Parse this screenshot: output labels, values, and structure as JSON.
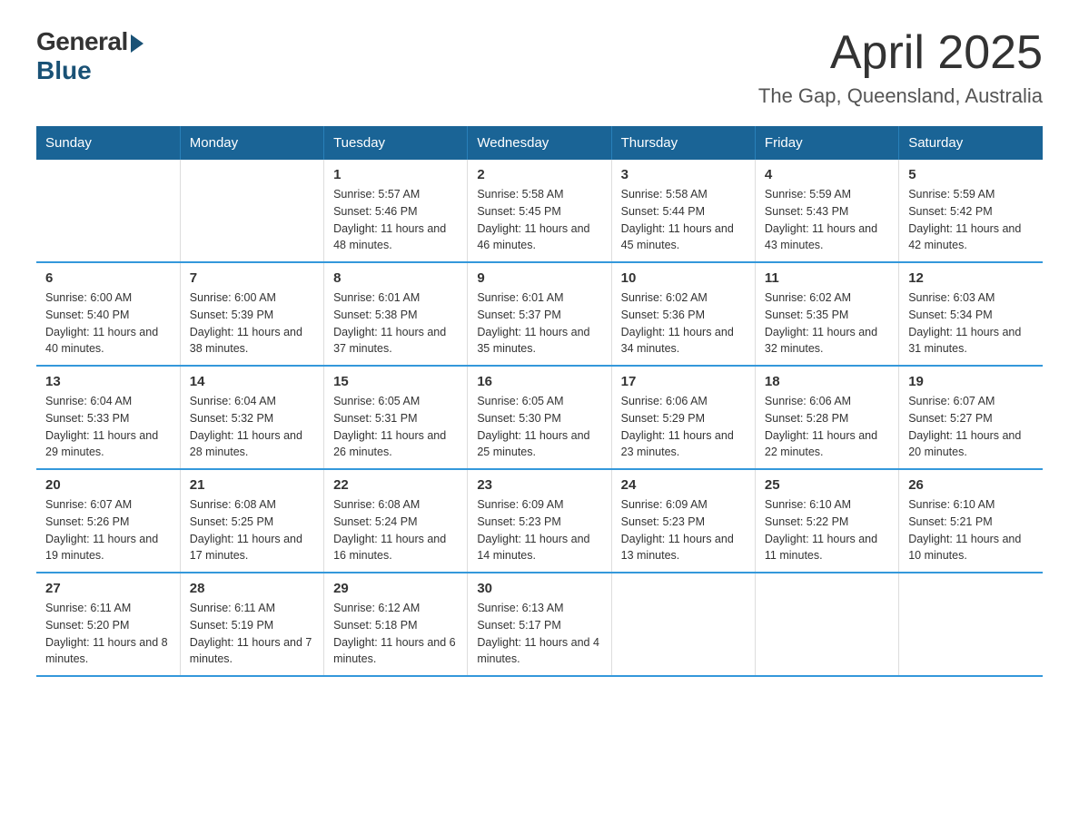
{
  "header": {
    "logo": {
      "general": "General",
      "blue": "Blue"
    },
    "title": "April 2025",
    "subtitle": "The Gap, Queensland, Australia"
  },
  "calendar": {
    "days_of_week": [
      "Sunday",
      "Monday",
      "Tuesday",
      "Wednesday",
      "Thursday",
      "Friday",
      "Saturday"
    ],
    "weeks": [
      [
        {
          "day": "",
          "sunrise": "",
          "sunset": "",
          "daylight": ""
        },
        {
          "day": "",
          "sunrise": "",
          "sunset": "",
          "daylight": ""
        },
        {
          "day": "1",
          "sunrise": "Sunrise: 5:57 AM",
          "sunset": "Sunset: 5:46 PM",
          "daylight": "Daylight: 11 hours and 48 minutes."
        },
        {
          "day": "2",
          "sunrise": "Sunrise: 5:58 AM",
          "sunset": "Sunset: 5:45 PM",
          "daylight": "Daylight: 11 hours and 46 minutes."
        },
        {
          "day": "3",
          "sunrise": "Sunrise: 5:58 AM",
          "sunset": "Sunset: 5:44 PM",
          "daylight": "Daylight: 11 hours and 45 minutes."
        },
        {
          "day": "4",
          "sunrise": "Sunrise: 5:59 AM",
          "sunset": "Sunset: 5:43 PM",
          "daylight": "Daylight: 11 hours and 43 minutes."
        },
        {
          "day": "5",
          "sunrise": "Sunrise: 5:59 AM",
          "sunset": "Sunset: 5:42 PM",
          "daylight": "Daylight: 11 hours and 42 minutes."
        }
      ],
      [
        {
          "day": "6",
          "sunrise": "Sunrise: 6:00 AM",
          "sunset": "Sunset: 5:40 PM",
          "daylight": "Daylight: 11 hours and 40 minutes."
        },
        {
          "day": "7",
          "sunrise": "Sunrise: 6:00 AM",
          "sunset": "Sunset: 5:39 PM",
          "daylight": "Daylight: 11 hours and 38 minutes."
        },
        {
          "day": "8",
          "sunrise": "Sunrise: 6:01 AM",
          "sunset": "Sunset: 5:38 PM",
          "daylight": "Daylight: 11 hours and 37 minutes."
        },
        {
          "day": "9",
          "sunrise": "Sunrise: 6:01 AM",
          "sunset": "Sunset: 5:37 PM",
          "daylight": "Daylight: 11 hours and 35 minutes."
        },
        {
          "day": "10",
          "sunrise": "Sunrise: 6:02 AM",
          "sunset": "Sunset: 5:36 PM",
          "daylight": "Daylight: 11 hours and 34 minutes."
        },
        {
          "day": "11",
          "sunrise": "Sunrise: 6:02 AM",
          "sunset": "Sunset: 5:35 PM",
          "daylight": "Daylight: 11 hours and 32 minutes."
        },
        {
          "day": "12",
          "sunrise": "Sunrise: 6:03 AM",
          "sunset": "Sunset: 5:34 PM",
          "daylight": "Daylight: 11 hours and 31 minutes."
        }
      ],
      [
        {
          "day": "13",
          "sunrise": "Sunrise: 6:04 AM",
          "sunset": "Sunset: 5:33 PM",
          "daylight": "Daylight: 11 hours and 29 minutes."
        },
        {
          "day": "14",
          "sunrise": "Sunrise: 6:04 AM",
          "sunset": "Sunset: 5:32 PM",
          "daylight": "Daylight: 11 hours and 28 minutes."
        },
        {
          "day": "15",
          "sunrise": "Sunrise: 6:05 AM",
          "sunset": "Sunset: 5:31 PM",
          "daylight": "Daylight: 11 hours and 26 minutes."
        },
        {
          "day": "16",
          "sunrise": "Sunrise: 6:05 AM",
          "sunset": "Sunset: 5:30 PM",
          "daylight": "Daylight: 11 hours and 25 minutes."
        },
        {
          "day": "17",
          "sunrise": "Sunrise: 6:06 AM",
          "sunset": "Sunset: 5:29 PM",
          "daylight": "Daylight: 11 hours and 23 minutes."
        },
        {
          "day": "18",
          "sunrise": "Sunrise: 6:06 AM",
          "sunset": "Sunset: 5:28 PM",
          "daylight": "Daylight: 11 hours and 22 minutes."
        },
        {
          "day": "19",
          "sunrise": "Sunrise: 6:07 AM",
          "sunset": "Sunset: 5:27 PM",
          "daylight": "Daylight: 11 hours and 20 minutes."
        }
      ],
      [
        {
          "day": "20",
          "sunrise": "Sunrise: 6:07 AM",
          "sunset": "Sunset: 5:26 PM",
          "daylight": "Daylight: 11 hours and 19 minutes."
        },
        {
          "day": "21",
          "sunrise": "Sunrise: 6:08 AM",
          "sunset": "Sunset: 5:25 PM",
          "daylight": "Daylight: 11 hours and 17 minutes."
        },
        {
          "day": "22",
          "sunrise": "Sunrise: 6:08 AM",
          "sunset": "Sunset: 5:24 PM",
          "daylight": "Daylight: 11 hours and 16 minutes."
        },
        {
          "day": "23",
          "sunrise": "Sunrise: 6:09 AM",
          "sunset": "Sunset: 5:23 PM",
          "daylight": "Daylight: 11 hours and 14 minutes."
        },
        {
          "day": "24",
          "sunrise": "Sunrise: 6:09 AM",
          "sunset": "Sunset: 5:23 PM",
          "daylight": "Daylight: 11 hours and 13 minutes."
        },
        {
          "day": "25",
          "sunrise": "Sunrise: 6:10 AM",
          "sunset": "Sunset: 5:22 PM",
          "daylight": "Daylight: 11 hours and 11 minutes."
        },
        {
          "day": "26",
          "sunrise": "Sunrise: 6:10 AM",
          "sunset": "Sunset: 5:21 PM",
          "daylight": "Daylight: 11 hours and 10 minutes."
        }
      ],
      [
        {
          "day": "27",
          "sunrise": "Sunrise: 6:11 AM",
          "sunset": "Sunset: 5:20 PM",
          "daylight": "Daylight: 11 hours and 8 minutes."
        },
        {
          "day": "28",
          "sunrise": "Sunrise: 6:11 AM",
          "sunset": "Sunset: 5:19 PM",
          "daylight": "Daylight: 11 hours and 7 minutes."
        },
        {
          "day": "29",
          "sunrise": "Sunrise: 6:12 AM",
          "sunset": "Sunset: 5:18 PM",
          "daylight": "Daylight: 11 hours and 6 minutes."
        },
        {
          "day": "30",
          "sunrise": "Sunrise: 6:13 AM",
          "sunset": "Sunset: 5:17 PM",
          "daylight": "Daylight: 11 hours and 4 minutes."
        },
        {
          "day": "",
          "sunrise": "",
          "sunset": "",
          "daylight": ""
        },
        {
          "day": "",
          "sunrise": "",
          "sunset": "",
          "daylight": ""
        },
        {
          "day": "",
          "sunrise": "",
          "sunset": "",
          "daylight": ""
        }
      ]
    ]
  }
}
